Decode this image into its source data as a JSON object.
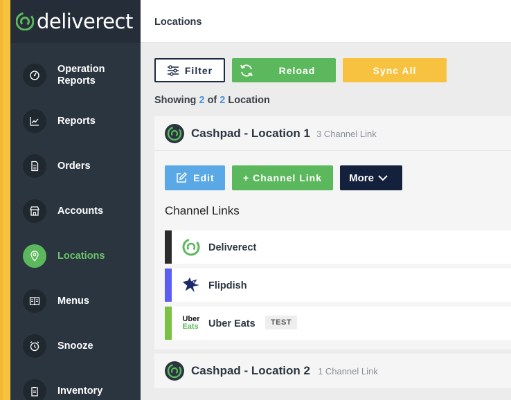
{
  "brand": {
    "name": "deliverect",
    "accent": "#5cb85c",
    "stripe": "#f7c23f"
  },
  "sidebar": {
    "items": [
      {
        "label": "Operation Reports",
        "icon": "gauge-icon",
        "active": false
      },
      {
        "label": "Reports",
        "icon": "chart-line-icon",
        "active": false
      },
      {
        "label": "Orders",
        "icon": "document-icon",
        "active": false
      },
      {
        "label": "Accounts",
        "icon": "store-icon",
        "active": false
      },
      {
        "label": "Locations",
        "icon": "map-pin-icon",
        "active": true
      },
      {
        "label": "Menus",
        "icon": "book-icon",
        "active": false
      },
      {
        "label": "Snooze",
        "icon": "alarm-clock-icon",
        "active": false
      },
      {
        "label": "Inventory",
        "icon": "clipboard-icon",
        "active": false
      }
    ]
  },
  "header": {
    "title": "Locations"
  },
  "toolbar": {
    "filter_label": "Filter",
    "reload_label": "Reload",
    "sync_label": "Sync All"
  },
  "summary": {
    "prefix": "Showing",
    "shown": "2",
    "of": "of",
    "total": "2",
    "suffix": "Location"
  },
  "locations": [
    {
      "name": "Cashpad - Location 1",
      "channel_count": "3 Channel Link",
      "actions": {
        "edit_label": "Edit",
        "channel_link_label": "+ Channel Link",
        "more_label": "More"
      },
      "channel_links_title": "Channel Links",
      "channel_links": [
        {
          "name": "Deliverect",
          "color": "#2b2b2b",
          "icon": "deliverect-icon"
        },
        {
          "name": "Flipdish",
          "color": "#5b5bf5",
          "icon": "flipdish-icon"
        },
        {
          "name": "Uber Eats",
          "color": "#7ac143",
          "icon": "uber-eats-icon",
          "tag": "TEST",
          "logo_top": "Uber",
          "logo_bottom": "Eats"
        }
      ]
    },
    {
      "name": "Cashpad - Location 2",
      "channel_count": "1 Channel Link"
    }
  ]
}
